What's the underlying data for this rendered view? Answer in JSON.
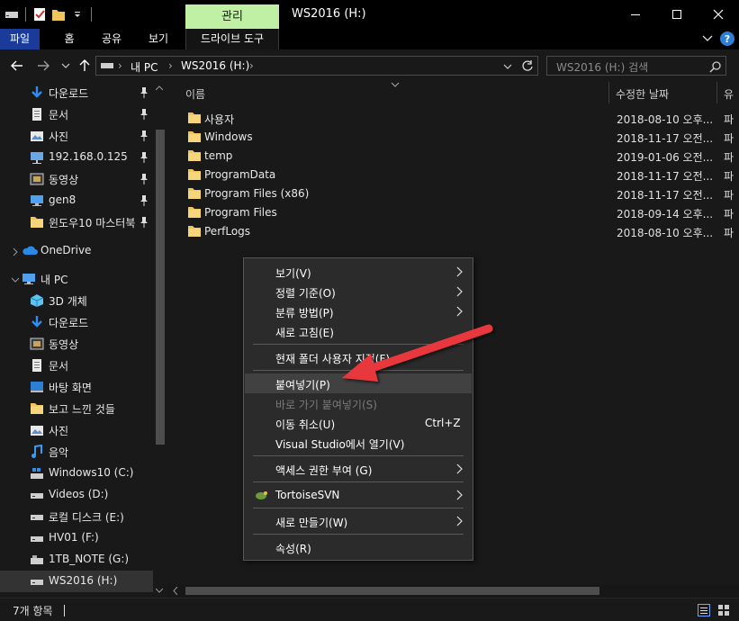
{
  "window": {
    "title": "WS2016 (H:)",
    "context_tab_label": "관리"
  },
  "ribbon": {
    "tabs": [
      "파일",
      "홈",
      "공유",
      "보기"
    ],
    "context_tab": "드라이브 도구"
  },
  "address": {
    "crumbs": [
      "내 PC",
      "WS2016 (H:)"
    ],
    "search_placeholder": "WS2016 (H:) 검색"
  },
  "sidebar": {
    "quick_access": [
      {
        "label": "다운로드",
        "icon": "download-icon",
        "pinned": true
      },
      {
        "label": "문서",
        "icon": "document-icon",
        "pinned": true
      },
      {
        "label": "사진",
        "icon": "picture-icon",
        "pinned": true
      },
      {
        "label": "192.168.0.125",
        "icon": "network-drive-icon",
        "pinned": true
      },
      {
        "label": "동영상",
        "icon": "video-icon",
        "pinned": true
      },
      {
        "label": "gen8",
        "icon": "computer-icon",
        "pinned": true
      },
      {
        "label": "윈도우10 마스터북",
        "icon": "folder-icon",
        "pinned": true
      }
    ],
    "onedrive": {
      "label": "OneDrive",
      "icon": "cloud-icon"
    },
    "this_pc": {
      "label": "내 PC",
      "icon": "pc-icon"
    },
    "pc_items": [
      {
        "label": "3D 개체",
        "icon": "cube-icon"
      },
      {
        "label": "다운로드",
        "icon": "download-icon"
      },
      {
        "label": "동영상",
        "icon": "video-icon"
      },
      {
        "label": "문서",
        "icon": "document-icon"
      },
      {
        "label": "바탕 화면",
        "icon": "desktop-icon"
      },
      {
        "label": "보고 느낀 것들",
        "icon": "folder-icon"
      },
      {
        "label": "사진",
        "icon": "picture-icon"
      },
      {
        "label": "음악",
        "icon": "music-icon"
      },
      {
        "label": "Windows10 (C:)",
        "icon": "windows-drive-icon"
      },
      {
        "label": "Videos (D:)",
        "icon": "drive-icon"
      },
      {
        "label": "로컬 디스크 (E:)",
        "icon": "drive-icon"
      },
      {
        "label": "HV01 (F:)",
        "icon": "drive-icon"
      },
      {
        "label": "1TB_NOTE (G:)",
        "icon": "usb-drive-icon"
      },
      {
        "label": "WS2016 (H:)",
        "icon": "drive-icon",
        "selected": true
      }
    ]
  },
  "content": {
    "columns": [
      "이름",
      "수정한 날짜",
      "유"
    ],
    "files": [
      {
        "name": "사용자",
        "date": "2018-08-10 오후...",
        "type": "파"
      },
      {
        "name": "Windows",
        "date": "2018-11-17 오전...",
        "type": "파"
      },
      {
        "name": "temp",
        "date": "2019-01-06 오전...",
        "type": "파"
      },
      {
        "name": "ProgramData",
        "date": "2018-11-17 오전...",
        "type": "파"
      },
      {
        "name": "Program Files (x86)",
        "date": "2018-11-17 오전...",
        "type": "파"
      },
      {
        "name": "Program Files",
        "date": "2018-09-14 오후...",
        "type": "파"
      },
      {
        "name": "PerfLogs",
        "date": "2018-08-10 오후...",
        "type": "파"
      }
    ]
  },
  "status": {
    "item_count": "7개 항목"
  },
  "context_menu": {
    "items": [
      {
        "label": "보기(V)",
        "submenu": true
      },
      {
        "label": "정렬 기준(O)",
        "submenu": true
      },
      {
        "label": "분류 방법(P)",
        "submenu": true
      },
      {
        "label": "새로 고침(E)"
      },
      {
        "separator": true
      },
      {
        "label": "현재 폴더 사용자 지정(F)..."
      },
      {
        "separator": true
      },
      {
        "label": "붙여넣기(P)",
        "highlighted": true
      },
      {
        "label": "바로 가기 붙여넣기(S)",
        "disabled": true
      },
      {
        "label": "이동 취소(U)",
        "shortcut": "Ctrl+Z"
      },
      {
        "label": "Visual Studio에서 열기(V)"
      },
      {
        "separator": true
      },
      {
        "label": "액세스 권한 부여 (G)",
        "submenu": true
      },
      {
        "separator": true
      },
      {
        "label": "TortoiseSVN",
        "submenu": true,
        "icon": "tortoise-icon"
      },
      {
        "separator": true
      },
      {
        "label": "새로 만들기(W)",
        "submenu": true
      },
      {
        "separator": true
      },
      {
        "label": "속성(R)"
      }
    ]
  },
  "colors": {
    "background": "#191919",
    "file_tab": "#1a3b9a",
    "context_tab": "#bff0a3",
    "annotation_arrow": "#e8383d",
    "folder": "#f2c55c"
  }
}
